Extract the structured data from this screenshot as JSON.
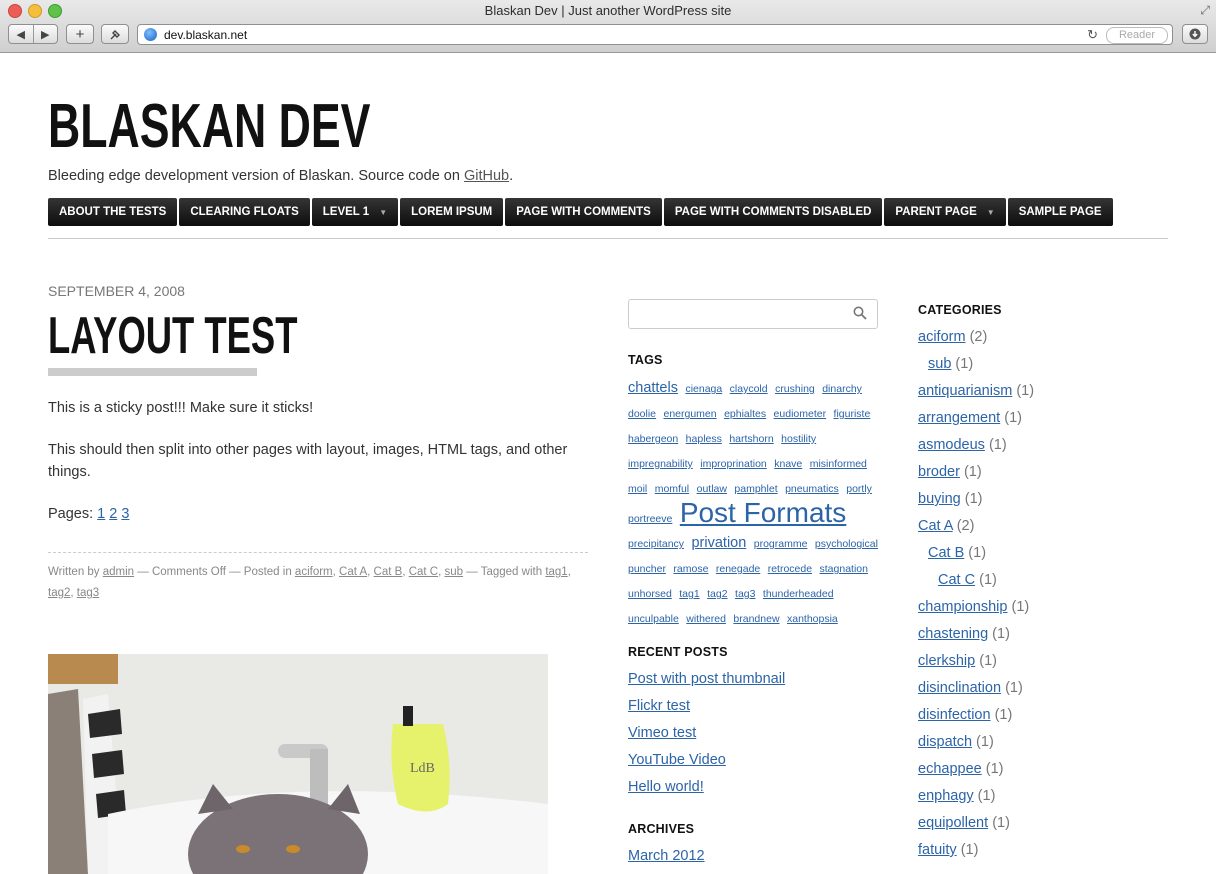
{
  "browser": {
    "window_title": "Blaskan Dev | Just another WordPress site",
    "url": "dev.blaskan.net",
    "reader_label": "Reader",
    "back_glyph": "◀",
    "forward_glyph": "▶",
    "add_glyph": "+",
    "icons": [
      "back-icon",
      "forward-icon",
      "add-tab-icon",
      "tools-icon",
      "globe-icon",
      "reload-icon",
      "downloads-icon",
      "resize-icon"
    ]
  },
  "site": {
    "title": "BLASKAN DEV",
    "description_prefix": "Bleeding edge development version of Blaskan. Source code on ",
    "description_link": "GitHub",
    "description_suffix": "."
  },
  "menu": [
    {
      "label": "ABOUT THE TESTS",
      "has_children": false
    },
    {
      "label": "CLEARING FLOATS",
      "has_children": false
    },
    {
      "label": "LEVEL 1",
      "has_children": true
    },
    {
      "label": "LOREM IPSUM",
      "has_children": false
    },
    {
      "label": "PAGE WITH COMMENTS",
      "has_children": false
    },
    {
      "label": "PAGE WITH COMMENTS DISABLED",
      "has_children": false
    },
    {
      "label": "PARENT PAGE",
      "has_children": true
    },
    {
      "label": "SAMPLE PAGE",
      "has_children": false
    }
  ],
  "post": {
    "date": "SEPTEMBER 4, 2008",
    "title": "LAYOUT TEST",
    "p1": "This is a sticky post!!! Make sure it sticks!",
    "p2": "This should then split into other pages with layout, images, HTML tags, and other things.",
    "pages_label": "Pages: ",
    "pages": [
      "1",
      "2",
      "3"
    ],
    "meta": {
      "written_by": "Written by ",
      "author": "admin",
      "comments": " — Comments Off — Posted in ",
      "categories": [
        "aciform",
        "Cat A",
        "Cat B",
        "Cat C",
        "sub"
      ],
      "tagged_with": " — Tagged with ",
      "tags": [
        "tag1",
        "tag2",
        "tag3"
      ]
    }
  },
  "sidebar": {
    "tags_heading": "TAGS",
    "tags": [
      {
        "name": "chattels",
        "size": 14.5
      },
      {
        "name": "cienaga",
        "size": 10.5
      },
      {
        "name": "claycold",
        "size": 10.5
      },
      {
        "name": "crushing",
        "size": 10.5
      },
      {
        "name": "dinarchy",
        "size": 10.5
      },
      {
        "name": "doolie",
        "size": 10.5
      },
      {
        "name": "energumen",
        "size": 10.5
      },
      {
        "name": "ephialtes",
        "size": 10.5
      },
      {
        "name": "eudiometer",
        "size": 10.5
      },
      {
        "name": "figuriste",
        "size": 10.5
      },
      {
        "name": "habergeon",
        "size": 10.5
      },
      {
        "name": "hapless",
        "size": 10.5
      },
      {
        "name": "hartshorn",
        "size": 10.5
      },
      {
        "name": "hostility impregnability",
        "size": 10.5
      },
      {
        "name": "improprination",
        "size": 10.5
      },
      {
        "name": "knave",
        "size": 10.5
      },
      {
        "name": "misinformed",
        "size": 10.5
      },
      {
        "name": "moil",
        "size": 10.5
      },
      {
        "name": "momful",
        "size": 10.5
      },
      {
        "name": "outlaw",
        "size": 10.5
      },
      {
        "name": "pamphlet",
        "size": 10.5
      },
      {
        "name": "pneumatics",
        "size": 10.5
      },
      {
        "name": "portly portreeve",
        "size": 10.5
      },
      {
        "name": "Post Formats",
        "size": 28
      },
      {
        "name": "precipitancy",
        "size": 10.5
      },
      {
        "name": "privation",
        "size": 14.5
      },
      {
        "name": "programme",
        "size": 10.5
      },
      {
        "name": "psychological",
        "size": 10.5
      },
      {
        "name": "puncher",
        "size": 10.5
      },
      {
        "name": "ramose",
        "size": 10.5
      },
      {
        "name": "renegade",
        "size": 10.5
      },
      {
        "name": "retrocede",
        "size": 10.5
      },
      {
        "name": "stagnation unhorsed",
        "size": 10.5
      },
      {
        "name": "tag1",
        "size": 10.5
      },
      {
        "name": "tag2",
        "size": 10.5
      },
      {
        "name": "tag3",
        "size": 10.5
      },
      {
        "name": "thunderheaded",
        "size": 10.5
      },
      {
        "name": "unculpable",
        "size": 10.5
      },
      {
        "name": "withered",
        "size": 10.5
      },
      {
        "name": "brandnew",
        "size": 10.5
      },
      {
        "name": "xanthopsia",
        "size": 10.5
      }
    ],
    "recent_heading": "RECENT POSTS",
    "recent": [
      "Post with post thumbnail",
      "Flickr test",
      "Vimeo test",
      "YouTube Video",
      "Hello world!"
    ],
    "archives_heading": "ARCHIVES",
    "archives": [
      "March 2012"
    ]
  },
  "categories": {
    "heading": "CATEGORIES",
    "items": [
      {
        "name": "aciform",
        "count": "(2)",
        "level": 0
      },
      {
        "name": "sub",
        "count": "(1)",
        "level": 1
      },
      {
        "name": "antiquarianism",
        "count": "(1)",
        "level": 0
      },
      {
        "name": "arrangement",
        "count": "(1)",
        "level": 0
      },
      {
        "name": "asmodeus",
        "count": "(1)",
        "level": 0
      },
      {
        "name": "broder",
        "count": "(1)",
        "level": 0
      },
      {
        "name": "buying",
        "count": "(1)",
        "level": 0
      },
      {
        "name": "Cat A",
        "count": "(2)",
        "level": 0
      },
      {
        "name": "Cat B",
        "count": "(1)",
        "level": 1
      },
      {
        "name": "Cat C",
        "count": "(1)",
        "level": 2
      },
      {
        "name": "championship",
        "count": "(1)",
        "level": 0
      },
      {
        "name": "chastening",
        "count": "(1)",
        "level": 0
      },
      {
        "name": "clerkship",
        "count": "(1)",
        "level": 0
      },
      {
        "name": "disinclination",
        "count": "(1)",
        "level": 0
      },
      {
        "name": "disinfection",
        "count": "(1)",
        "level": 0
      },
      {
        "name": "dispatch",
        "count": "(1)",
        "level": 0
      },
      {
        "name": "echappee",
        "count": "(1)",
        "level": 0
      },
      {
        "name": "enphagy",
        "count": "(1)",
        "level": 0
      },
      {
        "name": "equipollent",
        "count": "(1)",
        "level": 0
      },
      {
        "name": "fatuity",
        "count": "(1)",
        "level": 0
      }
    ]
  },
  "colors": {
    "link": "#2c64a8",
    "menu_bg": "#111111",
    "text": "#333333",
    "meta": "#888888"
  }
}
